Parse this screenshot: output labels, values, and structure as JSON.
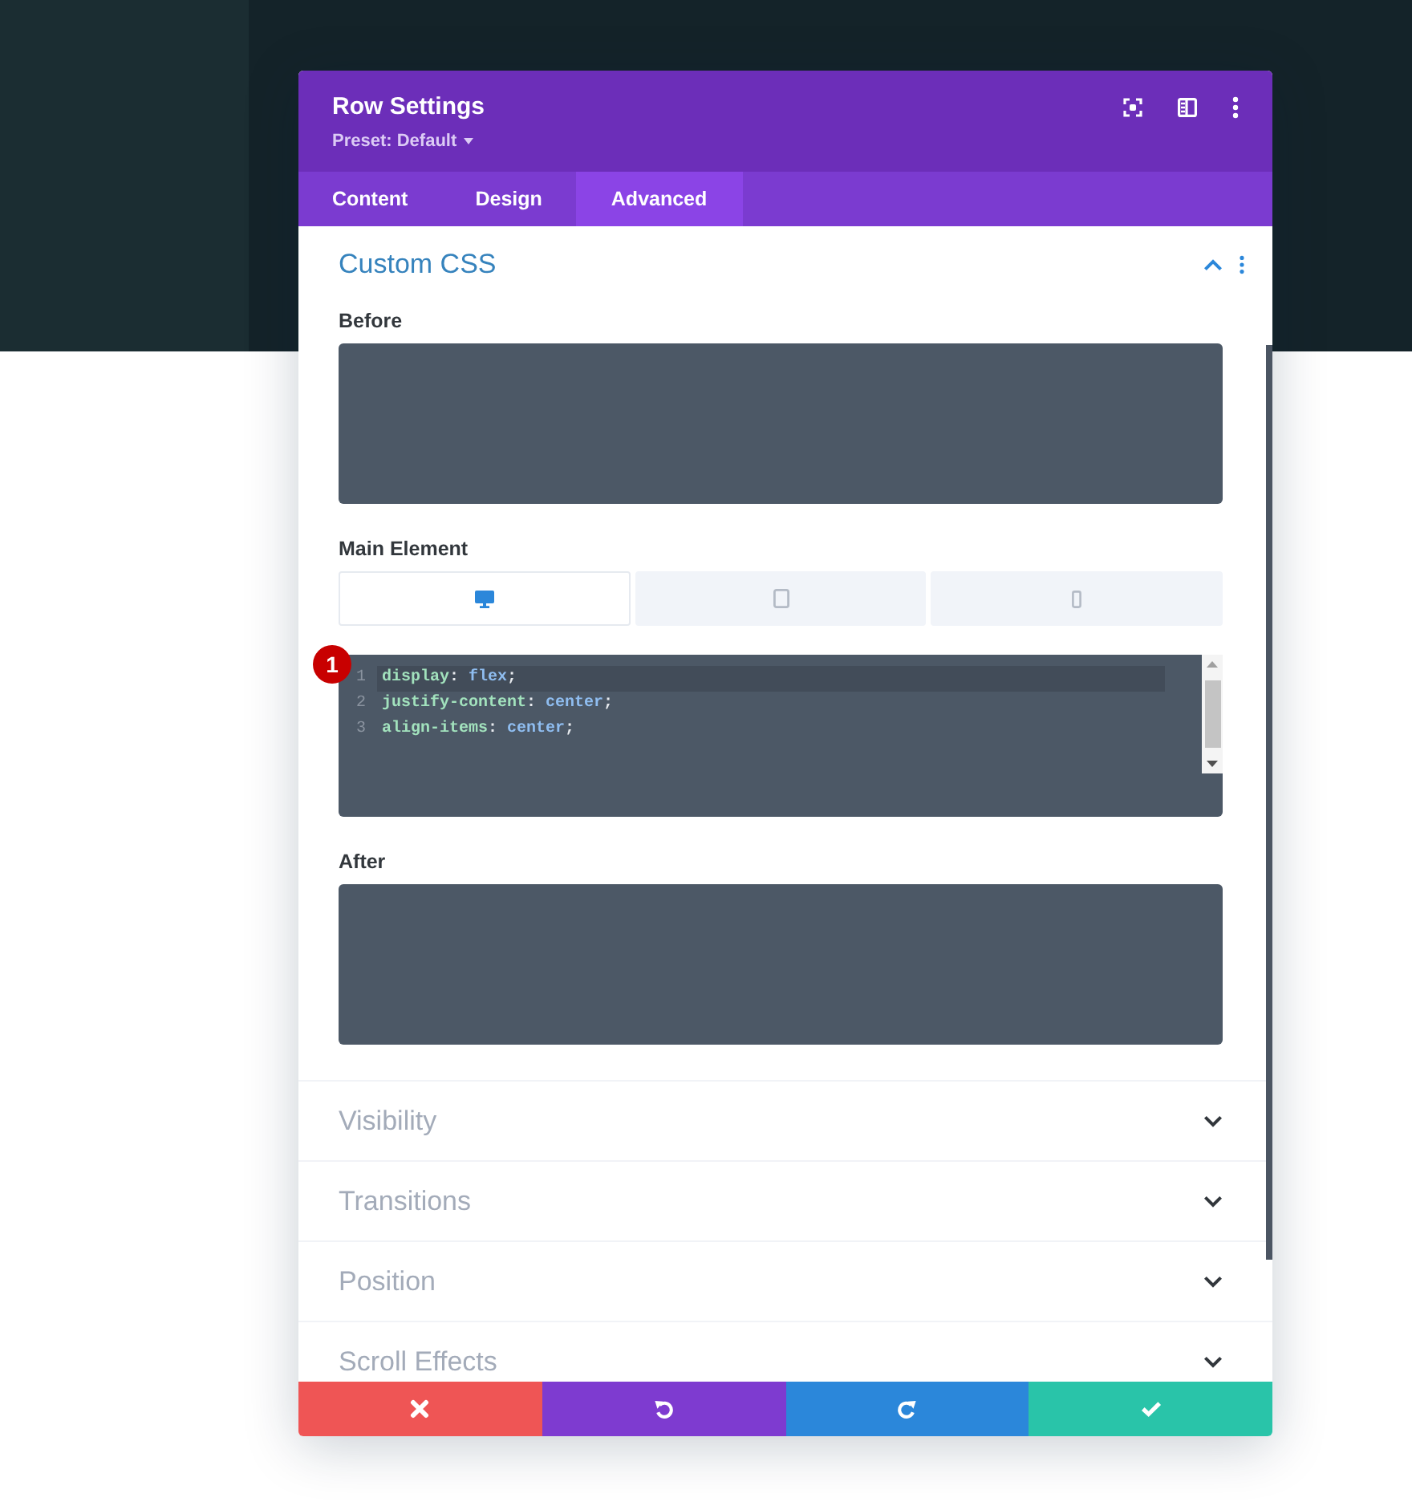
{
  "header": {
    "title": "Row Settings",
    "preset": "Preset: Default"
  },
  "tabs": [
    {
      "label": "Content",
      "selected": false
    },
    {
      "label": "Design",
      "selected": false
    },
    {
      "label": "Advanced",
      "selected": true
    }
  ],
  "sections": [
    {
      "title": "Custom CSS",
      "expanded": true,
      "fields": [
        {
          "kind": "textarea",
          "label": "Before"
        },
        {
          "kind": "code",
          "label": "Main Element",
          "devices": [
            {
              "kind": "desktop",
              "selected": true
            },
            {
              "kind": "tablet",
              "selected": false
            },
            {
              "kind": "phone",
              "selected": false
            }
          ],
          "marker": "1",
          "lines": [
            {
              "number": "1",
              "active": true,
              "tokens": [
                {
                  "kind": "property",
                  "text": "display"
                },
                {
                  "kind": "punctuation",
                  "text": ": "
                },
                {
                  "kind": "value",
                  "text": "flex"
                },
                {
                  "kind": "punctuation",
                  "text": ";"
                }
              ]
            },
            {
              "number": "2",
              "active": false,
              "tokens": [
                {
                  "kind": "property",
                  "text": "justify-content"
                },
                {
                  "kind": "punctuation",
                  "text": ": "
                },
                {
                  "kind": "value",
                  "text": "center"
                },
                {
                  "kind": "punctuation",
                  "text": ";"
                }
              ]
            },
            {
              "number": "3",
              "active": false,
              "tokens": [
                {
                  "kind": "property",
                  "text": "align-items"
                },
                {
                  "kind": "punctuation",
                  "text": ": "
                },
                {
                  "kind": "value",
                  "text": "center"
                },
                {
                  "kind": "punctuation",
                  "text": ";"
                }
              ]
            }
          ]
        },
        {
          "kind": "textarea",
          "label": "After"
        }
      ]
    },
    {
      "title": "Visibility",
      "expanded": false
    },
    {
      "title": "Transitions",
      "expanded": false
    },
    {
      "title": "Position",
      "expanded": false
    },
    {
      "title": "Scroll Effects",
      "expanded": false
    }
  ],
  "footer_buttons": [
    {
      "kind": "discard"
    },
    {
      "kind": "undo"
    },
    {
      "kind": "redo"
    },
    {
      "kind": "save"
    }
  ]
}
